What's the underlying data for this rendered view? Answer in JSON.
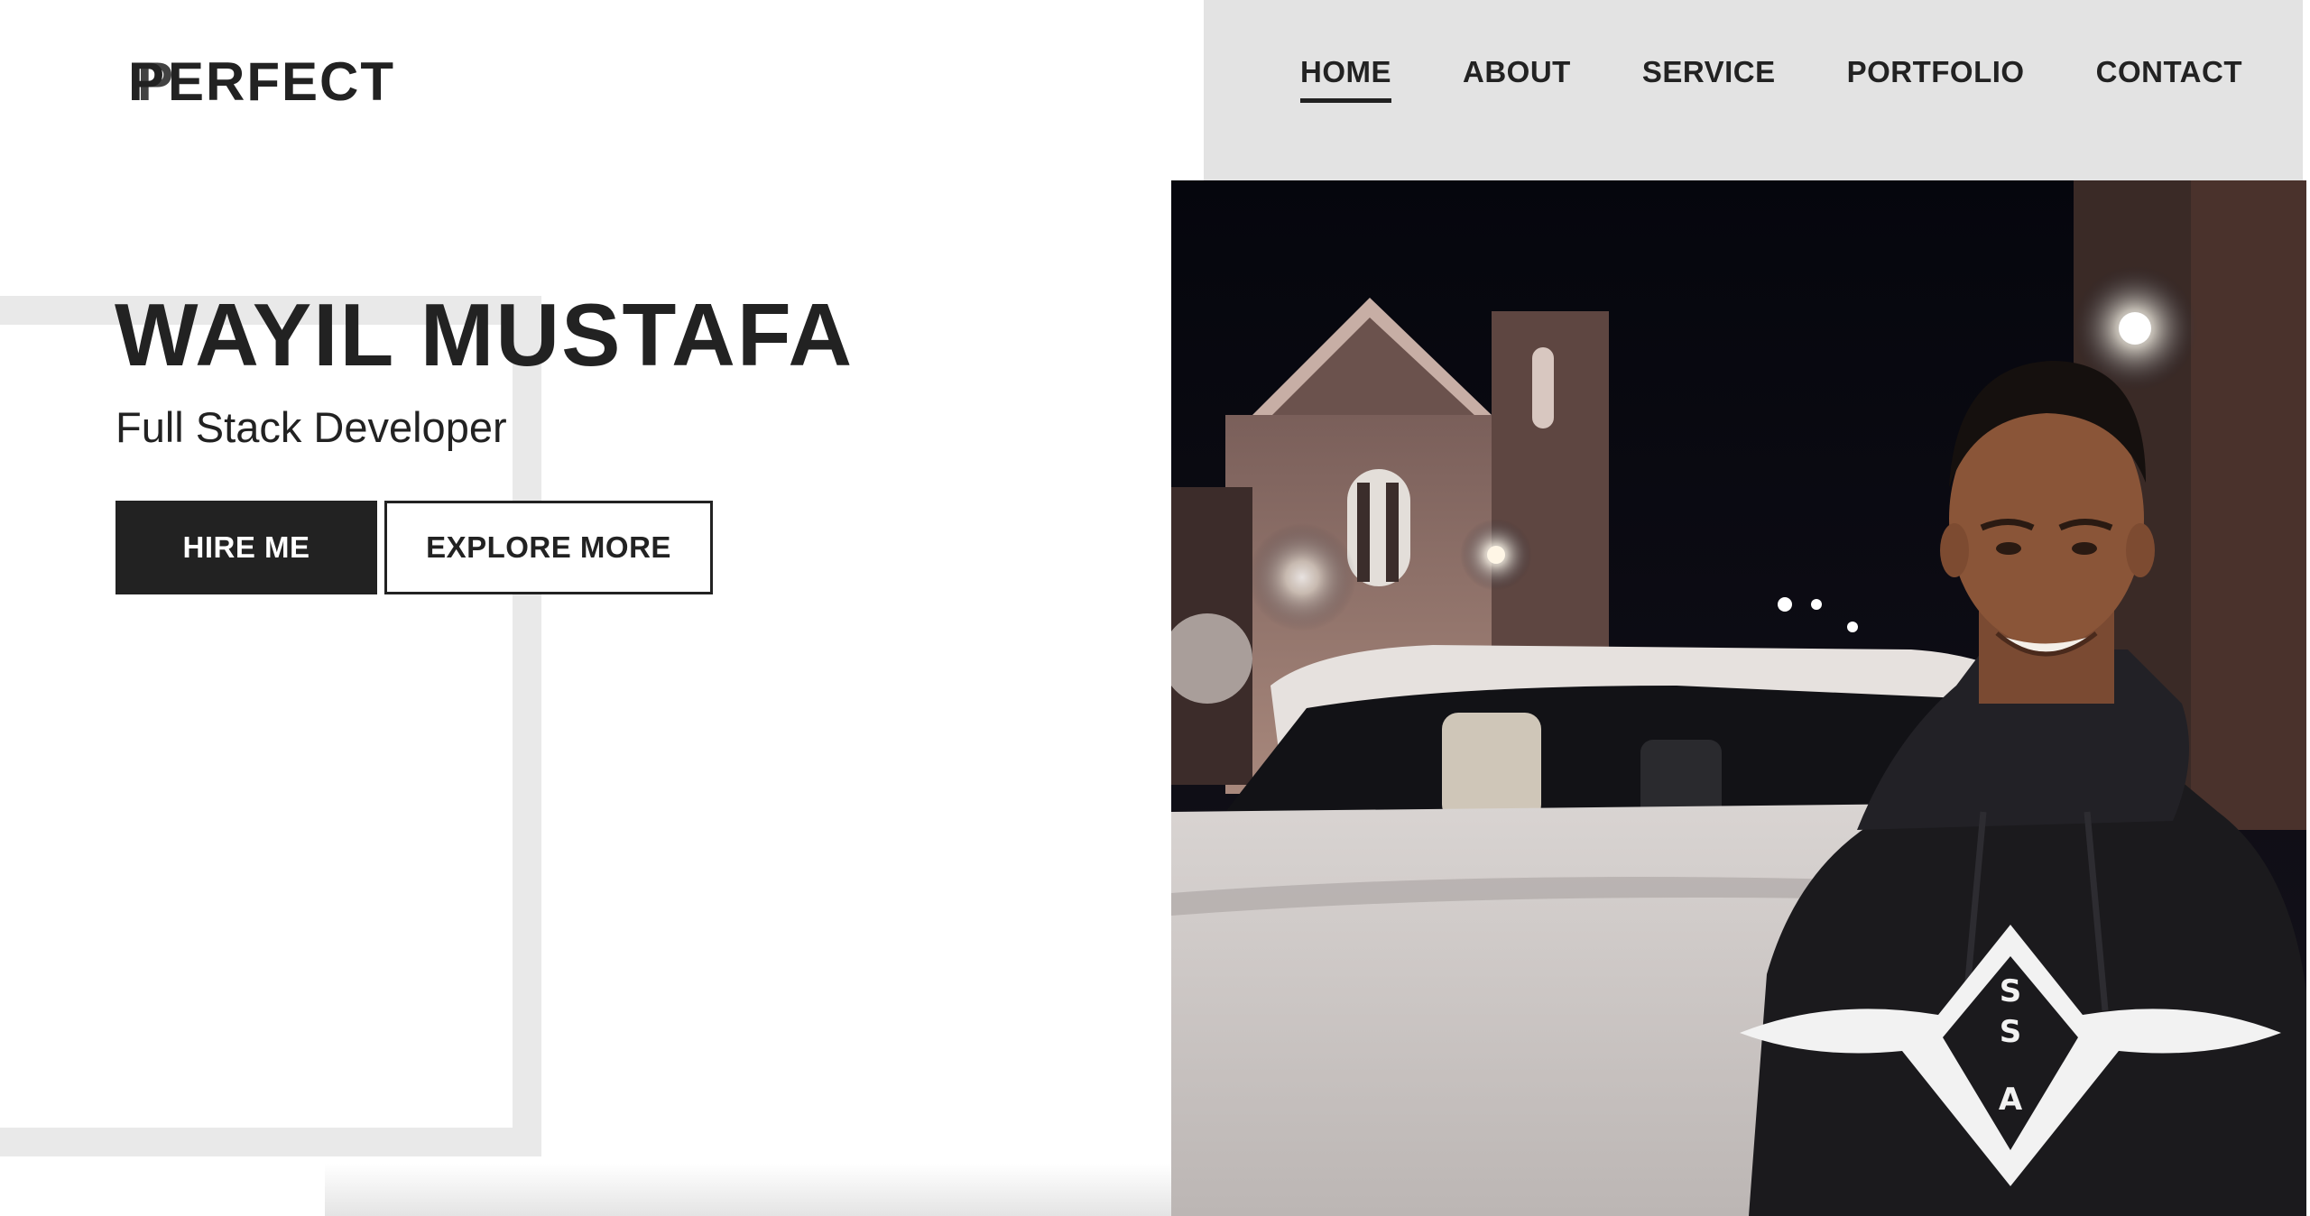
{
  "header": {
    "logo_text": "ERFECT",
    "logo_mark": "P"
  },
  "nav": {
    "items": [
      {
        "label": "HOME",
        "active": true
      },
      {
        "label": "ABOUT",
        "active": false
      },
      {
        "label": "SERVICE",
        "active": false
      },
      {
        "label": "PORTFOLIO",
        "active": false
      },
      {
        "label": "CONTACT",
        "active": false
      }
    ]
  },
  "hero": {
    "name": "WAYIL MUSTAFA",
    "role": "Full Stack Developer",
    "hire_label": "HIRE ME",
    "explore_label": "EXPLORE MORE"
  },
  "photo": {
    "hoodie_text": "SSA"
  },
  "colors": {
    "dark": "#222222",
    "nav_bg": "#e3e3e3",
    "frame": "#e9e9e9",
    "background": "#ffffff"
  }
}
